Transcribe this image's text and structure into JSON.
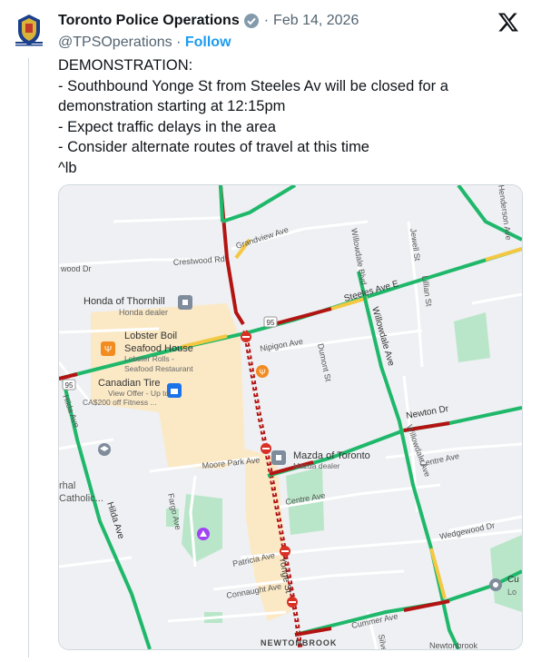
{
  "account": {
    "name": "Toronto Police Operations",
    "handle": "@TPSOperations",
    "follow_label": "Follow",
    "date": "Feb 14, 2026",
    "separator": "·"
  },
  "tweet": {
    "lines": [
      "DEMONSTRATION:",
      "- Southbound Yonge St from Steeles Av will be closed for a",
      "demonstration starting at 12:15pm",
      "- Expect traffic delays in the area",
      "- Consider alternate routes of travel at this time",
      "^lb"
    ]
  },
  "map": {
    "roads": {
      "crestwood": "Crestwood Rd",
      "grandview": "Grandview Ave",
      "steeles": "Steeles Ave E",
      "nipigon": "Nipigon Ave",
      "dumont": "Dumont St",
      "newton": "Newton Dr",
      "moore_park": "Moore Park Ave",
      "centre_east": "Centre Ave",
      "centre_west": "Centre Ave",
      "fargo": "Fargo Ave",
      "patricia": "Patricia Ave",
      "connaught": "Connaught Ave",
      "yonge": "Yonge St",
      "wedgewood": "Wedgewood Dr",
      "cummer": "Cummer Ave",
      "willowdale_blvd": "Willowdale Blvd",
      "willowdale_ave": "Willowdale Ave",
      "jewell": "Jewell St",
      "lillian": "Lillian St",
      "hilda": "Hilda Ave",
      "henderson": "Henderson Ave",
      "wood_dr": "wood Dr",
      "silver": "Silver",
      "hwy_shield": "95"
    },
    "places": {
      "honda_name": "Honda of Thornhill",
      "honda_sub": "Honda dealer",
      "lobster_name_1": "Lobster Boil",
      "lobster_name_2": "Seafood House",
      "lobster_sub_1": "Lobster Rolls -",
      "lobster_sub_2": "Seafood Restaurant",
      "tire_name": "Canadian Tire",
      "tire_sub_1": "View Offer - Up to",
      "tire_sub_2": "CA$200 off Fitness ...",
      "mazda_name": "Mazda of Toronto",
      "mazda_sub": "Mazda dealer",
      "catholic_1": "rhal",
      "catholic_2": "Catholic...",
      "cu_1": "Cu",
      "cu_2": "Lo",
      "newtonbrook": "NEWTONBROOK",
      "newtonbrook_2": "Newtonbrook"
    },
    "colors": {
      "traffic_green": "#1fb86b",
      "traffic_yellow": "#f5c842",
      "traffic_red": "#b31412",
      "closure_red": "#d93025",
      "commercial": "#fbe9c6",
      "park": "#b9e6c9",
      "water": "#aadaff"
    }
  }
}
